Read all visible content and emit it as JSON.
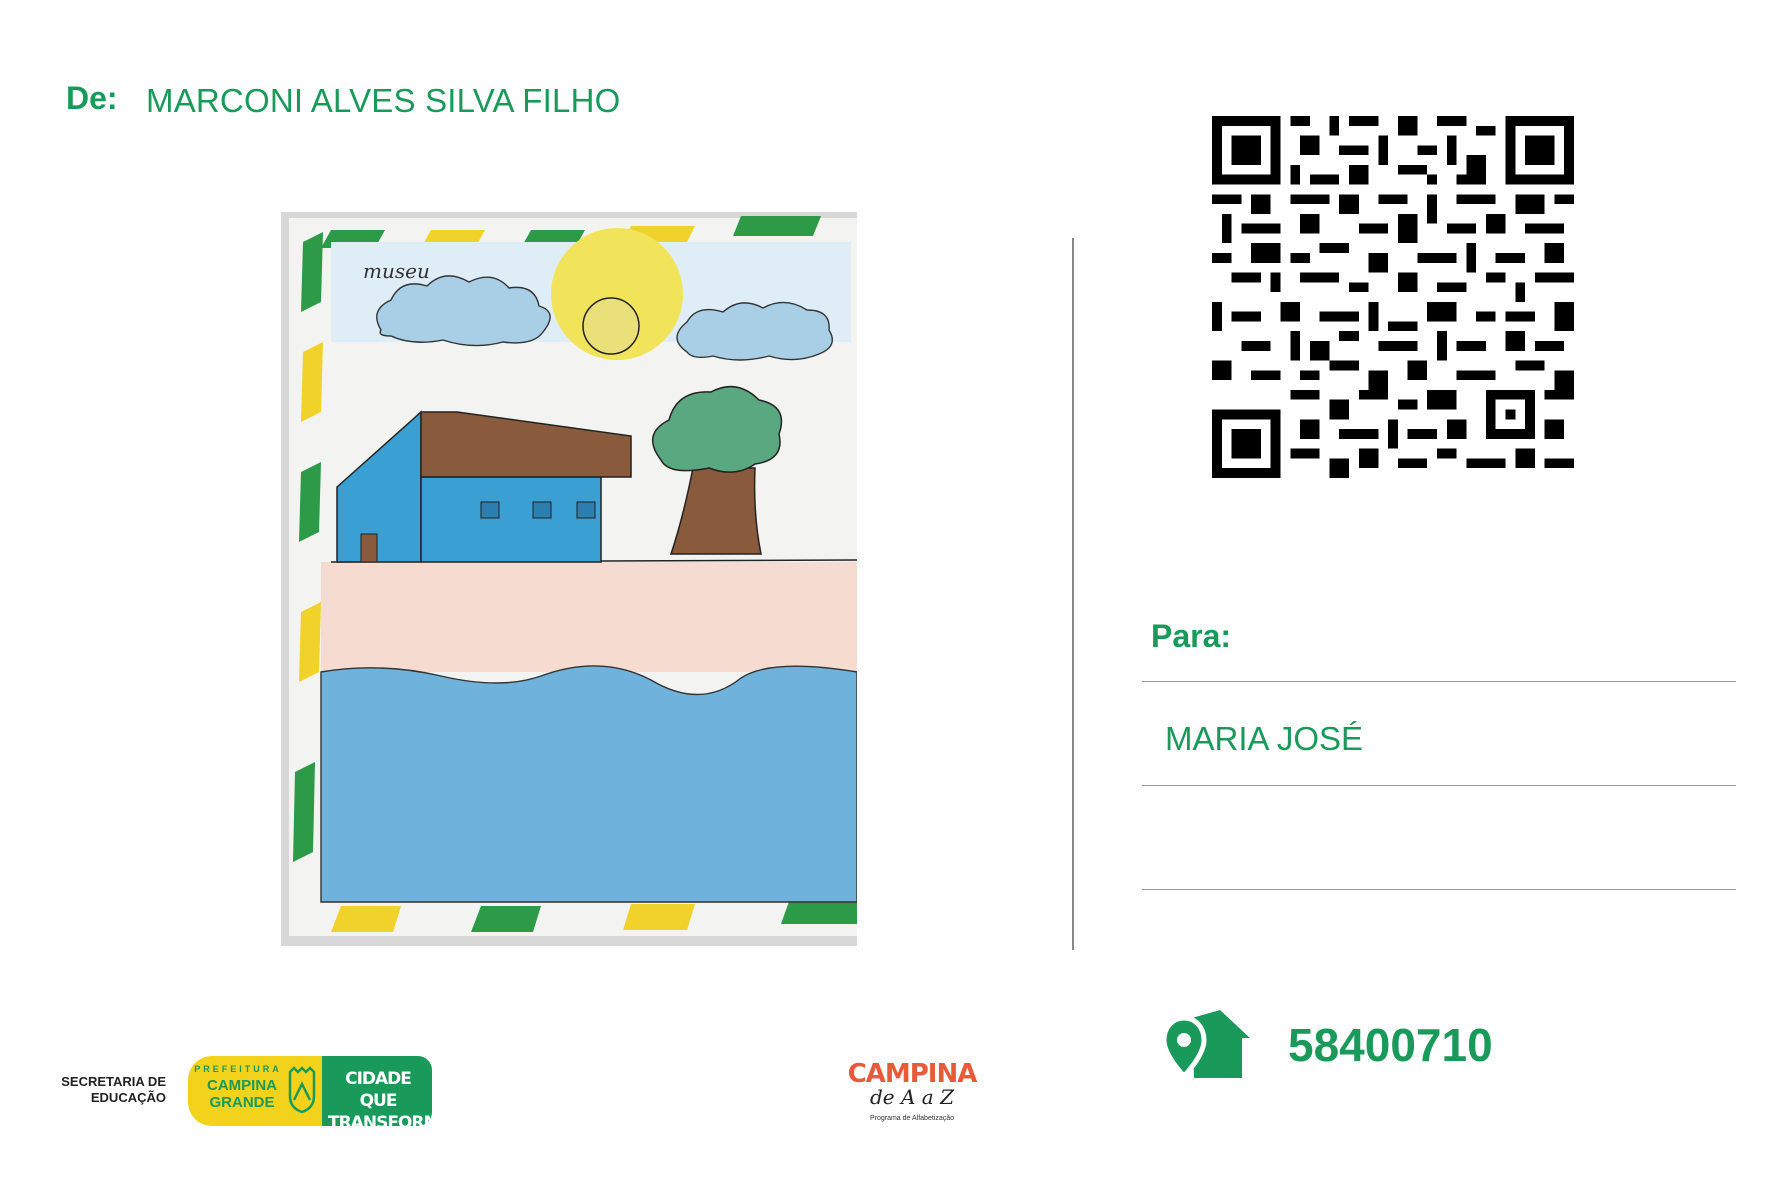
{
  "sender": {
    "label": "De:",
    "name": "MARCONI ALVES SILVA FILHO"
  },
  "recipient": {
    "label": "Para:",
    "name": "MARIA JOSÉ"
  },
  "postal": {
    "cep": "58400710",
    "icon": "house-location-icon"
  },
  "drawing": {
    "scribble": "museu"
  },
  "footer": {
    "secretaria": "SECRETARIA DE EDUCAÇÃO",
    "prefeitura_prefix": "PREFEITURA",
    "prefeitura_name": "CAMPINA GRANDE",
    "slogan": "CIDADE QUE TRANSFORMA",
    "program_title": "CAMPINA",
    "program_sub": "de A a Z",
    "program_caption": "Programa de Alfabetização"
  },
  "colors": {
    "accent": "#1a9a5a",
    "yellow": "#f2d21a"
  }
}
